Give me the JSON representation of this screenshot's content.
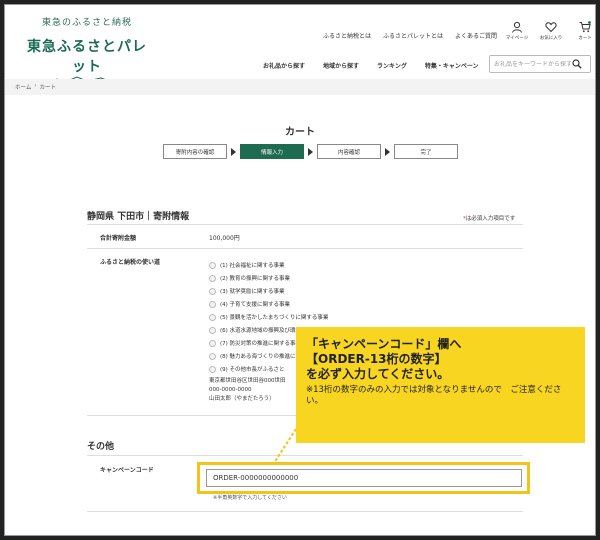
{
  "header": {
    "logo_sub": "東急のふるさと納税",
    "logo_main": "東急ふるさとパレット",
    "top_links": [
      "ふるさと納税とは",
      "ふるさとパレットとは",
      "よくあるご質問"
    ],
    "icons": [
      {
        "name": "user-icon",
        "label": "マイページ"
      },
      {
        "name": "heart-icon",
        "label": "お気に入り"
      },
      {
        "name": "cart-icon",
        "label": "カート"
      }
    ],
    "nav": [
      "お礼品から探す",
      "地域から探す",
      "ランキング",
      "特集・キャンペーン"
    ],
    "search_placeholder": "お礼品をキーワードから探す"
  },
  "breadcrumb": {
    "home": "ホーム",
    "sep": "›",
    "current": "カート"
  },
  "page_title": "カート",
  "steps": [
    {
      "label": "寄附内容の確認",
      "active": false
    },
    {
      "label": "情報入力",
      "active": true
    },
    {
      "label": "内容確認",
      "active": false
    },
    {
      "label": "完了",
      "active": false
    }
  ],
  "section1": {
    "title": "静岡県 下田市｜寄附情報",
    "required_note": "は必須入力項目です",
    "required_star": "*",
    "total_label": "合計寄附金額",
    "total_value": "100,000円",
    "usage_label": "ふるさと納税の使い道",
    "usage_options": [
      "(1) 社会福祉に関する事業",
      "(2) 教育の振興に関する事業",
      "(3) 就学奨励に関する事業",
      "(4) 子育て支援に関する事業",
      "(5) 景観を活かしたまちづくりに関する事業",
      "(6) 水道水源地域の振興及び環境保全に関する事業",
      "(7) 防災対策の推進に関する事業",
      "(8) 魅力ある海づくりの推進に関する事業",
      "(9) その他市長がふるさと"
    ],
    "address_lines": [
      "東京都世田谷区世田谷000世田",
      "000-0000-0000",
      "山田太郎（やまだたろう）"
    ]
  },
  "section2": {
    "title": "その他",
    "campaign_label": "キャンペーンコード",
    "campaign_value": "ORDER-0000000000000",
    "campaign_hint": "※半角英数字で入力してください"
  },
  "callout": {
    "line1": "「キャンペーンコード」欄へ",
    "line2": "【ORDER‐13桁の数字】",
    "line3": "を必ず入力してください。",
    "note": "※13桁の数字のみの入力では対象となりませんので　ご注意ください。"
  },
  "colors": {
    "brand": "#1f6b52",
    "callout": "#f8d521",
    "highlight_border": "#f0c419"
  }
}
